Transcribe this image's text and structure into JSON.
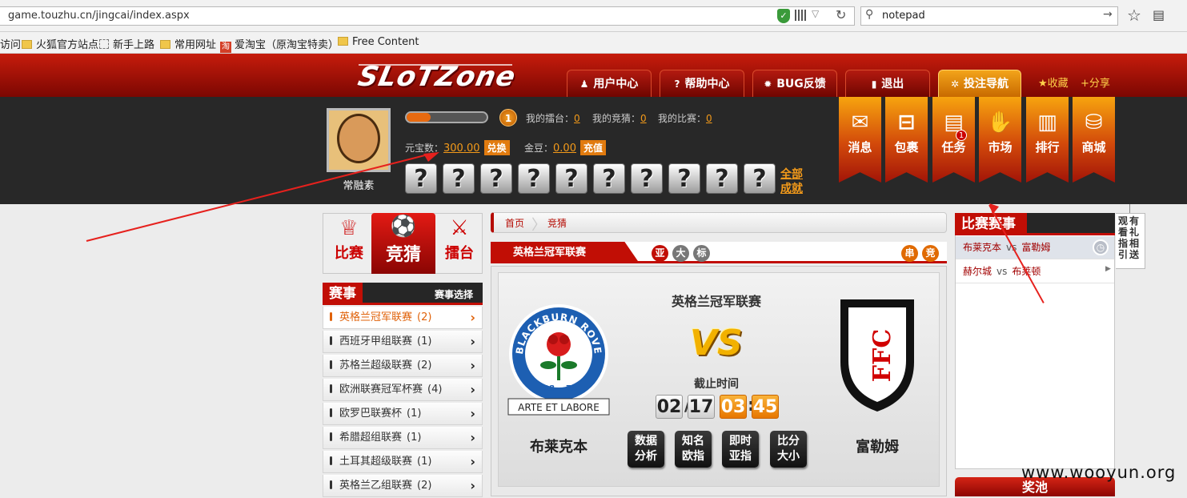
{
  "browser": {
    "url": "game.touzhu.cn/jingcai/index.aspx",
    "search_value": "notepad",
    "bookmarks": [
      "访问",
      "火狐官方站点",
      "新手上路",
      "常用网址",
      "爱淘宝（原淘宝特卖）",
      "Free Content"
    ]
  },
  "header": {
    "logo": "SLoTZone",
    "nav": [
      "用户中心",
      "帮助中心",
      "BUG反馈",
      "退出",
      "投注导航"
    ],
    "links": [
      "收藏",
      "分享"
    ]
  },
  "user": {
    "name": "常融素",
    "level": "1",
    "stats": [
      {
        "label": "我的擂台：",
        "value": "0"
      },
      {
        "label": "我的竞猜：",
        "value": "0"
      },
      {
        "label": "我的比赛：",
        "value": "0"
      }
    ],
    "yuanbao_label": "元宝数：",
    "yuanbao": "300.00",
    "exchange": "兑换",
    "jindou_label": "金豆：",
    "jindou": "0.00",
    "recharge": "充值",
    "achievement_placeholder": "?",
    "all_achievements": [
      "全部",
      "成就"
    ],
    "xp_fraction": 0.3
  },
  "ribbons": [
    {
      "label": "消息",
      "icon": "✉"
    },
    {
      "label": "包裹",
      "icon": "⊟"
    },
    {
      "label": "任务",
      "icon": "▤",
      "badge": "1"
    },
    {
      "label": "市场",
      "icon": "✋"
    },
    {
      "label": "排行",
      "icon": "▥"
    },
    {
      "label": "商城",
      "icon": "⛁"
    }
  ],
  "mode_tabs": [
    "比赛",
    "竞猜",
    "擂台"
  ],
  "leagues": {
    "title": "赛事",
    "select": "赛事选择",
    "items": [
      {
        "name": "英格兰冠军联赛",
        "count": "(2)"
      },
      {
        "name": "西班牙甲组联赛",
        "count": "(1)"
      },
      {
        "name": "苏格兰超级联赛",
        "count": "(2)"
      },
      {
        "name": "欧洲联赛冠军杯赛",
        "count": "(4)"
      },
      {
        "name": "欧罗巴联赛杯",
        "count": "(1)"
      },
      {
        "name": "希腊超组联赛",
        "count": "(1)"
      },
      {
        "name": "土耳其超级联赛",
        "count": "(1)"
      },
      {
        "name": "英格兰乙组联赛",
        "count": "(2)"
      }
    ]
  },
  "breadcrumb": {
    "home": "首页",
    "current": "竞猜"
  },
  "match": {
    "tab_title": "英格兰冠军联赛",
    "pills": [
      "亚",
      "大",
      "标"
    ],
    "right_pills": [
      "串",
      "竞"
    ],
    "league": "英格兰冠军联赛",
    "vs": "VS",
    "deadline_label": "截止时间",
    "date": [
      "02",
      "17"
    ],
    "time": [
      "03",
      "45"
    ],
    "home_team": "布莱克本",
    "away_team": "富勒姆",
    "home_crest_text": "BLACKBURN ROVERS F.C.",
    "home_crest_years": [
      "18",
      "75"
    ],
    "home_motto": "ARTE ET LABORE",
    "away_crest_text": "FFC",
    "actions": [
      [
        "数据",
        "分析"
      ],
      [
        "知名",
        "欧指"
      ],
      [
        "即时",
        "亚指"
      ],
      [
        "比分",
        "大小"
      ]
    ]
  },
  "right": {
    "title": "比赛赛事",
    "games": [
      {
        "home": "布莱克本",
        "vs": "vs",
        "away": "富勒姆"
      },
      {
        "home": "赫尔城",
        "vs": "vs",
        "away": "布莱顿"
      }
    ],
    "guide": [
      "观看指引",
      "有礼相送"
    ],
    "pool": "奖池"
  },
  "watermark": "www.wooyun.org"
}
